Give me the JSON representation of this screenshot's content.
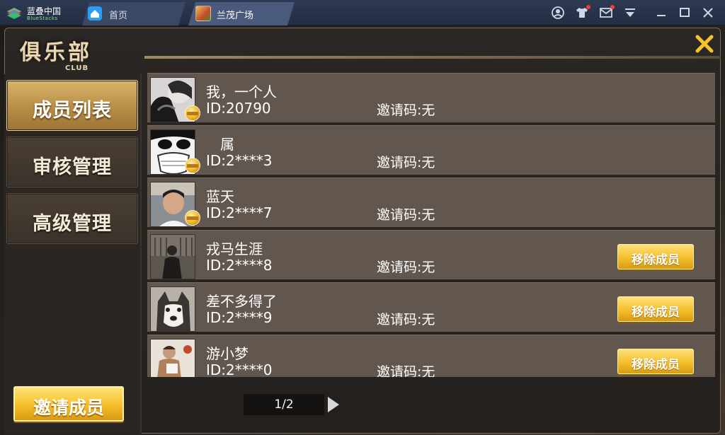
{
  "titlebar": {
    "brand_name": "蓝叠中国",
    "brand_sub": "BlueStacks",
    "tabs": [
      {
        "label": "首页",
        "icon": "home-icon"
      },
      {
        "label": "兰茂广场",
        "icon": "game-app-icon"
      }
    ],
    "icons": [
      "account-icon",
      "shirt-icon",
      "mail-icon",
      "dropdown-icon",
      "minimize-icon",
      "maximize-icon",
      "close-window-icon"
    ]
  },
  "club": {
    "title_cn": "俱乐部",
    "title_en": "CLUB"
  },
  "sidebar": {
    "items": [
      {
        "label": "成员列表",
        "active": true
      },
      {
        "label": "审核管理",
        "active": false
      },
      {
        "label": "高级管理",
        "active": false
      }
    ],
    "invite_label": "邀请成员"
  },
  "members": [
    {
      "name": "我，一个人",
      "id": "ID:20790",
      "invite": "邀请码:无",
      "badge": true,
      "remove": ""
    },
    {
      "name": "　属",
      "id": "ID:2****3",
      "invite": "邀请码:无",
      "badge": true,
      "remove": ""
    },
    {
      "name": "蓝天",
      "id": "ID:2****7",
      "invite": "邀请码:无",
      "badge": true,
      "remove": ""
    },
    {
      "name": "戎马生涯",
      "id": "ID:2****8",
      "invite": "邀请码:无",
      "badge": false,
      "remove": "移除成员"
    },
    {
      "name": "差不多得了",
      "id": "ID:2****9",
      "invite": "邀请码:无",
      "badge": false,
      "remove": "移除成员"
    },
    {
      "name": "游小梦",
      "id": "ID:2****0",
      "invite": "邀请码:无",
      "badge": false,
      "remove": "移除成员"
    }
  ],
  "pager": {
    "label": "1/2"
  },
  "colors": {
    "accent_gold": "#f3bf2a",
    "titlebar": "#2d3a52",
    "row_bg": "#62574f"
  }
}
